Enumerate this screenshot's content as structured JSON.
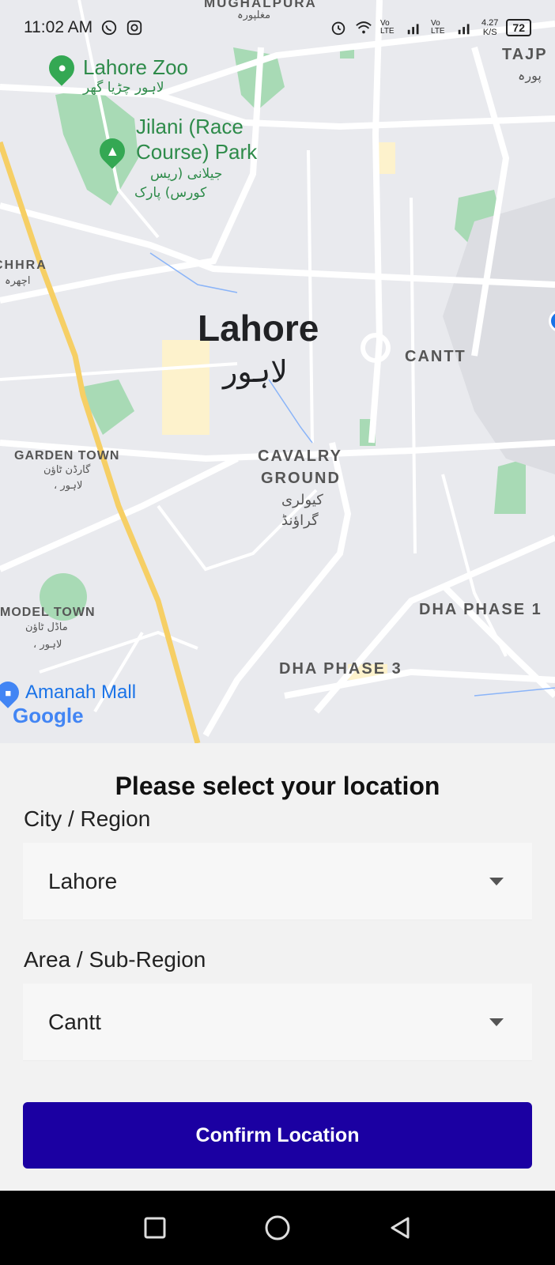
{
  "status_bar": {
    "time": "11:02 AM",
    "icons": [
      "whatsapp-icon",
      "instagram-icon"
    ],
    "right_icons": [
      "alarm-icon",
      "wifi-icon",
      "volte-signal-icon",
      "volte-signal-icon"
    ],
    "vo_lte_label_1": "Vo LTE",
    "vo_lte_label_2": "Vo LTE",
    "speed": "4.27",
    "speed_unit": "K/S",
    "battery": "72"
  },
  "map": {
    "labels": {
      "mughalpura": "MUGHALPURA",
      "mughalpura_urdu": "مغلپورہ",
      "tajpura": "TAJP",
      "tajpura_urdu": "پورہ",
      "lahore_zoo": "Lahore Zoo",
      "lahore_zoo_urdu": "لاہور چڑیا گھر",
      "jilani_park_1": "Jilani (Race",
      "jilani_park_2": "Course) Park",
      "jilani_park_urdu_1": "جیلانی (ریس",
      "jilani_park_urdu_2": "کورس) پارک",
      "ichhra": "CHHRA",
      "ichhra_urdu": "اچھرہ",
      "city": "Lahore",
      "city_urdu": "لاہور",
      "cantt": "CANTT",
      "garden_town": "GARDEN TOWN",
      "garden_town_urdu_1": "گارڈن ٹاؤن",
      "garden_town_urdu_2": "، لاہور",
      "cavalry_1": "CAVALRY",
      "cavalry_2": "GROUND",
      "cavalry_urdu_1": "کیولری",
      "cavalry_urdu_2": "گراؤنڈ",
      "model_town": "MODEL TOWN",
      "model_town_urdu_1": "ماڈل ٹاؤن",
      "model_town_urdu_2": "، لاہور",
      "dha1": "DHA PHASE 1",
      "dha3": "DHA PHASE 3",
      "amanah": "Amanah Mall",
      "google": "Google"
    },
    "colors": {
      "road": "#ffffff",
      "highway": "#f6cf65",
      "park": "#a8dab5",
      "water": "#8ab4f8",
      "background": "#e9eaee"
    }
  },
  "sheet": {
    "title": "Please select your location",
    "city_label": "City / Region",
    "city_value": "Lahore",
    "area_label": "Area / Sub-Region",
    "area_value": "Cantt",
    "confirm_label": "Confirm Location"
  },
  "nav": {
    "icons": [
      "recent-apps-icon",
      "home-icon",
      "back-icon"
    ]
  },
  "colors": {
    "primary": "#1b00a2"
  }
}
